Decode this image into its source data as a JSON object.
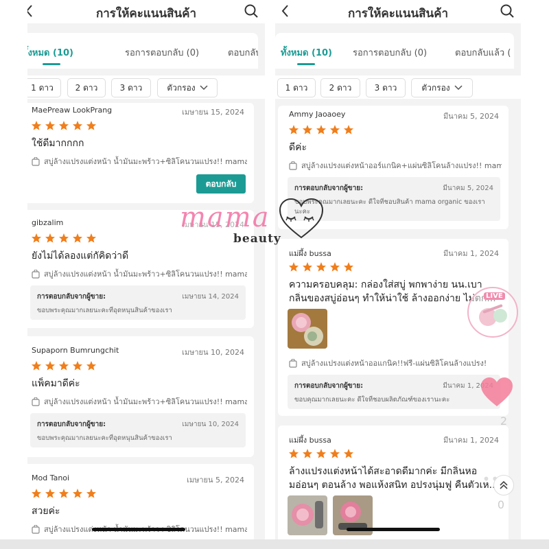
{
  "colors": {
    "accent": "#1c9b94",
    "star": "#f07e1b"
  },
  "header": {
    "title": "การให้คะแนนสินค้า"
  },
  "tabs": [
    {
      "label": "ทั้งหมด (10)",
      "active": true
    },
    {
      "label": "รอการตอบกลับ (0)"
    },
    {
      "label": "ตอบกลับแล้ว ("
    }
  ],
  "filters": {
    "one_star": "1 ดาว",
    "two_star": "2 ดาว",
    "three_star": "3 ดาว",
    "filter": "ตัวกรอง"
  },
  "reply_header": "การตอบกลับจากผู้ขาย:",
  "reply_button": "ตอบกลับ",
  "left_reviews": [
    {
      "reviewer": "MaePreaw LookPrang",
      "date": "เมษายน 15, 2024",
      "stars": 5,
      "text": "ใช้ดีมากกกก",
      "product": "สบู่ล้างแปรงแต่งหน้า น้ำมันมะพร้าว+ซิลิโคนวนแปรง!! mama or..."
    },
    {
      "reviewer": "gibzalim",
      "date": "เมษายน 15, 2024",
      "stars": 5,
      "text": "ยังไม่ได้ลองแต่กัคิดว่าดี",
      "product": "สบู่ล้างแปรงแต่งหน้า น้ำมันมะพร้าว+ซิลิโคนวนแปรง!! mama or...",
      "reply_date": "เมษายน 14, 2024",
      "reply_text": "ขอบพระคุณมากเลยนะคะที่อุดหนุนสินค้าของเรา"
    },
    {
      "reviewer": "Supaporn Bumrungchit",
      "date": "เมษายน 10, 2024",
      "stars": 5,
      "text": "แพ็คมาดีค่ะ",
      "product": "สบู่ล้างแปรงแต่งหน้า น้ำมันมะพร้าว+ซิลิโคนวนแปรง!! mama or...",
      "reply_date": "เมษายน 10, 2024",
      "reply_text": "ขอบพระคุณมากเลยนะคะที่อุดหนุนสินค้าของเรา"
    },
    {
      "reviewer": "Mod Tanoi",
      "date": "เมษายน 5, 2024",
      "stars": 5,
      "text": "สวยค่ะ",
      "product": "สบู่ล้างแปรงแต่งหน้า น้ำมันมะพร้าว+ซิลิโคนวนแปรง!! mama or..."
    }
  ],
  "right_reviews": [
    {
      "reviewer": "Ammy Jaoaoey",
      "date": "มีนาคม 5, 2024",
      "stars": 5,
      "text": "ดีค่ะ",
      "product": "สบู่ล้างแปรงแต่งหน้าออร์แกนิค+แผ่นซิลิโคนล้างแปรง!! mama o...",
      "reply_date": "มีนาคม 5, 2024",
      "reply_text_1": "ขอบพระคุณมากเลยนะคะ ดีใจที่ชอบสินค้า mama organic ของเรา",
      "reply_text_2": "นะคะ"
    },
    {
      "reviewer": "แม่ผึ้ง bussa",
      "date": "มีนาคม 1, 2024",
      "stars": 5,
      "text_1": "ความครอบคลุม: กล่องใส่สบู่ พกพาง่าย นน.เบา",
      "text_2": "กลิ่นของสบู่อ่อนๆ ทำให้น่าใช้ ล้างออกง่าย ไม่ตก...",
      "product": "สบู่ล้างแปรงแต่งหน้าออแกนิค!!ฟรี-แผ่นซิลิโคนล้างแปรง!",
      "reply_date": "มีนาคม 1, 2024",
      "reply_text": "ขอบคุณมากเลยนะคะ ดีใจที่ชอบผลิตภัณฑ์ของเรานะคะ"
    },
    {
      "reviewer": "แม่ผึ้ง bussa",
      "date": "มีนาคม 1, 2024",
      "stars": 5,
      "text_1": "ล้างแปรงแต่งหน้าได้สะอาดดีมากค่ะ มีกลิ่นหอ",
      "text_2": "มอ่อนๆ ตอนล้าง พอแห้งสนิท อปรงนุ่มฟู คืนตัวเห..."
    }
  ],
  "watermark": {
    "brand": "mama",
    "sub": "beauty"
  },
  "overlay": {
    "live": "LIVE",
    "likes": "2",
    "comments": "0",
    "more": "•••"
  }
}
